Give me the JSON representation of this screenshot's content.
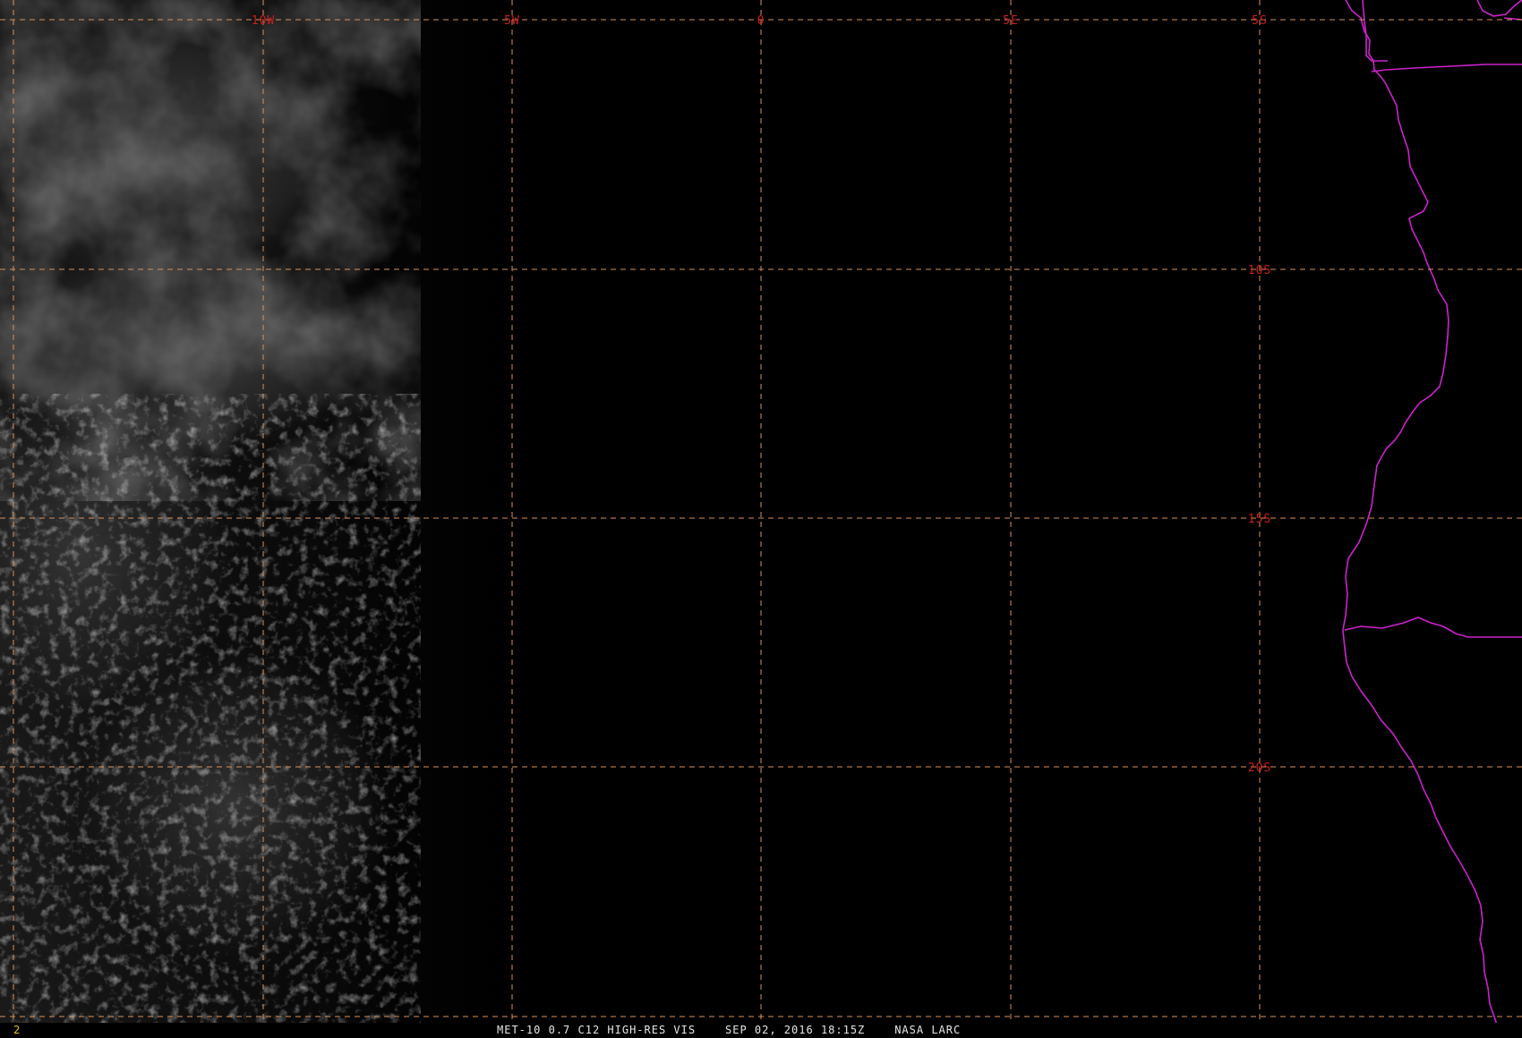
{
  "colors": {
    "background": "#000000",
    "grid": "#d9925c",
    "grid_label": "#cc1f1f",
    "coastline": "#cc22cc",
    "caption": "#e6e6e6",
    "frame_number": "#e0c020"
  },
  "grid": {
    "longitude_labels": [
      "10W",
      "5W",
      "0",
      "5E"
    ],
    "latitude_labels": [
      "5S",
      "10S",
      "15S",
      "20S"
    ]
  },
  "caption": {
    "frame_number": "2",
    "satellite": "MET-10",
    "channel": "0.7 C12 HIGH-RES VIS",
    "date": "SEP 02, 2016",
    "time": "18:15Z",
    "source": "NASA LARC"
  }
}
